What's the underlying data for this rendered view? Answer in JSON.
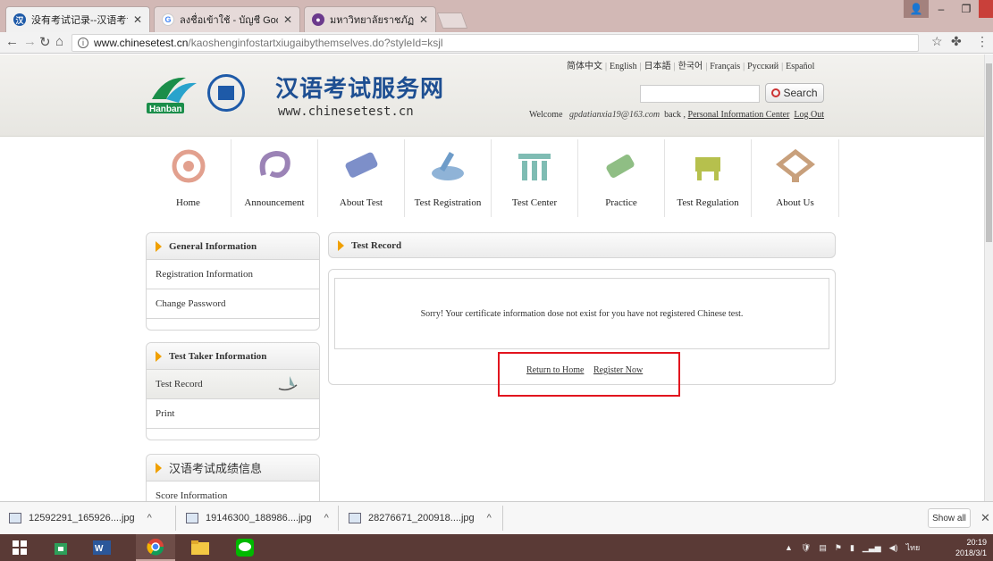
{
  "browser": {
    "tabs": [
      {
        "title": "没有考试记录--汉语考试",
        "icon": "hanban-icon"
      },
      {
        "title": "ลงชื่อเข้าใช้ - บัญชี Google",
        "icon": "google-icon"
      },
      {
        "title": "มหาวิทยาลัยราชภัฏเพชรบุรี",
        "icon": "university-icon"
      }
    ],
    "url_host": "www.chinesetest.cn",
    "url_path": "/kaoshenginfostartxiugaibythemselves.do?styleId=ksjl"
  },
  "header": {
    "site_title": "汉语考试服务网",
    "site_url": "www.chinesetest.cn",
    "logo_text": "Hanban",
    "languages": [
      "简体中文",
      "English",
      "日本語",
      "한국어",
      "Français",
      "Русский",
      "Español"
    ],
    "search_label": "Search",
    "welcome_prefix": "Welcome",
    "welcome_user": "gpdatianxia19@163.com",
    "back_label": "back ,",
    "personal_center": "Personal Information Center",
    "logout": "Log Out"
  },
  "nav": [
    {
      "label": "Home",
      "icon": "home-icon",
      "color": "#e2a08e"
    },
    {
      "label": "Announcement",
      "icon": "announcement-icon",
      "color": "#9b83b6"
    },
    {
      "label": "About Test",
      "icon": "scroll-icon",
      "color": "#7d8fc9"
    },
    {
      "label": "Test Registration",
      "icon": "registration-icon",
      "color": "#8fb3d7"
    },
    {
      "label": "Test Center",
      "icon": "building-icon",
      "color": "#7fbcb3"
    },
    {
      "label": "Practice",
      "icon": "practice-icon",
      "color": "#8fbe84"
    },
    {
      "label": "Test Regulation",
      "icon": "regulation-icon",
      "color": "#b6c04d"
    },
    {
      "label": "About Us",
      "icon": "about-us-icon",
      "color": "#c8a07c"
    }
  ],
  "sidebar": {
    "general": {
      "title": "General Information",
      "items": [
        "Registration Information",
        "Change Password"
      ]
    },
    "taker": {
      "title": "Test Taker Information",
      "items": [
        "Test Record",
        "Print"
      ]
    },
    "scores": {
      "title": "汉语考试成绩信息",
      "items": [
        "Score Information"
      ]
    }
  },
  "main": {
    "title": "Test Record",
    "message": "Sorry! Your certificate information dose not exist for you have not registered Chinese test.",
    "return_home": "Return to Home",
    "register_now": "Register Now"
  },
  "downloads": {
    "items": [
      "12592291_165926....jpg",
      "19146300_188986....jpg",
      "28276671_200918....jpg"
    ],
    "show_all": "Show all"
  },
  "taskbar": {
    "ime": "ไทย",
    "time": "20:19",
    "date": "2018/3/1"
  }
}
